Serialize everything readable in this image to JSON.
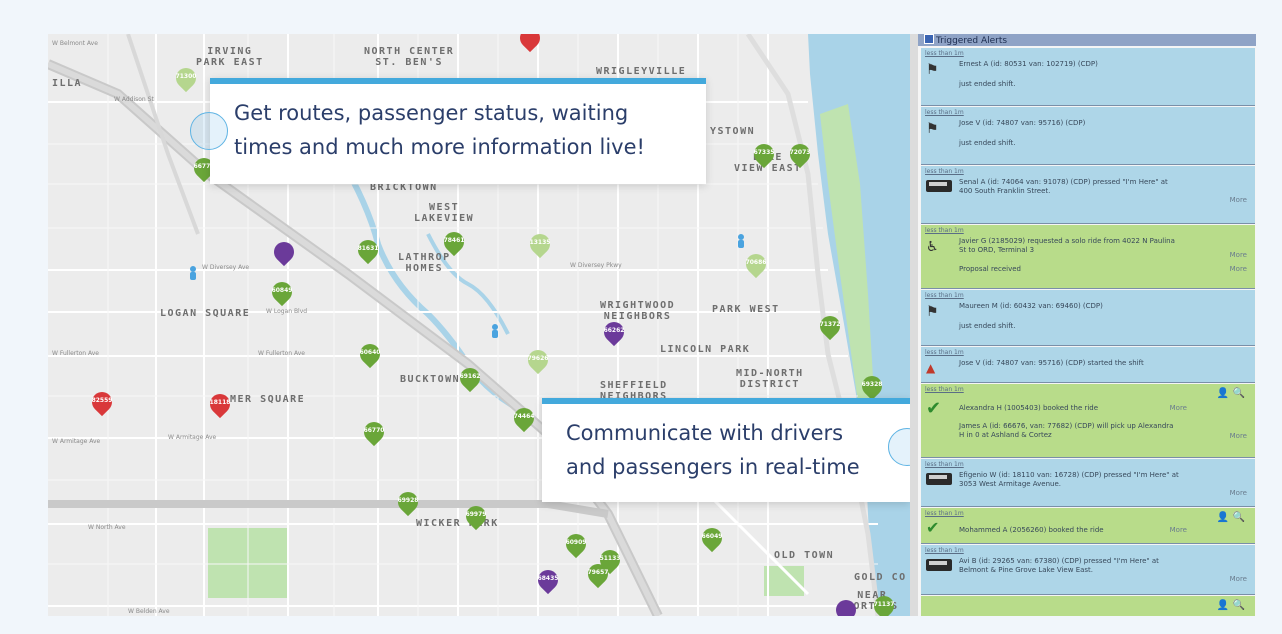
{
  "map": {
    "neighborhoods": [
      {
        "id": "irving-park-east",
        "text": "IRVING\nPARK EAST"
      },
      {
        "id": "north-center",
        "text": "NORTH CENTER\nST. BEN'S"
      },
      {
        "id": "wrigleyville",
        "text": "WRIGLEYVILLE"
      },
      {
        "id": "illa",
        "text": "ILLA"
      },
      {
        "id": "boystown",
        "text": "YSTOWN"
      },
      {
        "id": "lake-view-east",
        "text": "LAKE\nVIEW EAST"
      },
      {
        "id": "bricktown",
        "text": "BRICKTOWN"
      },
      {
        "id": "west-lakeview",
        "text": "WEST\nLAKEVIEW"
      },
      {
        "id": "lathrop-homes",
        "text": "LATHROP\nHOMES"
      },
      {
        "id": "wrightwood",
        "text": "WRIGHTWOOD\nNEIGHBORS"
      },
      {
        "id": "park-west",
        "text": "PARK WEST"
      },
      {
        "id": "logan-square",
        "text": "LOGAN SQUARE"
      },
      {
        "id": "lincoln-park",
        "text": "LINCOLN PARK"
      },
      {
        "id": "mid-north",
        "text": "MID-NORTH\nDISTRICT"
      },
      {
        "id": "bucktown",
        "text": "BUCKTOWN"
      },
      {
        "id": "sheffield",
        "text": "SHEFFIELD\nNEIGHBORS"
      },
      {
        "id": "palmer-square",
        "text": "MER SQUARE"
      },
      {
        "id": "wicker-park",
        "text": "WICKER PARK"
      },
      {
        "id": "old-town",
        "text": "OLD TOWN"
      },
      {
        "id": "gold-coast",
        "text": "GOLD CO"
      },
      {
        "id": "near-north",
        "text": "NEAR\nNORTH S"
      }
    ],
    "streets": [
      {
        "id": "addison",
        "text": "W Addison St"
      },
      {
        "id": "diversey-1",
        "text": "W Diversey Ave"
      },
      {
        "id": "diversey-2",
        "text": "W Diversey Pkwy"
      },
      {
        "id": "logan-blvd",
        "text": "W Logan Blvd"
      },
      {
        "id": "fullerton-1",
        "text": "W Fullerton Ave"
      },
      {
        "id": "fullerton-2",
        "text": "W Fullerton Ave"
      },
      {
        "id": "armitage-1",
        "text": "W Armitage Ave"
      },
      {
        "id": "armitage-2",
        "text": "W Armitage Ave"
      },
      {
        "id": "north-ave",
        "text": "W North Ave"
      },
      {
        "id": "belmont",
        "text": "W Belmont Ave"
      },
      {
        "id": "beldon",
        "text": "W Belden Ave"
      }
    ],
    "pins": [
      {
        "id": "p1",
        "number": "71300",
        "color": "lime"
      },
      {
        "id": "p2",
        "number": "",
        "color": "red"
      },
      {
        "id": "p3",
        "number": "66775",
        "color": "green"
      },
      {
        "id": "p4",
        "number": "72073",
        "color": "green"
      },
      {
        "id": "p5",
        "number": "67335",
        "color": "green"
      },
      {
        "id": "p6",
        "number": "81631",
        "color": "green"
      },
      {
        "id": "p7",
        "number": "78461",
        "color": "green"
      },
      {
        "id": "p8",
        "number": "13135",
        "color": "lime"
      },
      {
        "id": "p9",
        "number": "",
        "color": "purple"
      },
      {
        "id": "p10",
        "number": "60849",
        "color": "green"
      },
      {
        "id": "p11",
        "number": "70686",
        "color": "lime"
      },
      {
        "id": "p12",
        "number": "66262",
        "color": "purple"
      },
      {
        "id": "p13",
        "number": "71372",
        "color": "green"
      },
      {
        "id": "p14",
        "number": "60640",
        "color": "green"
      },
      {
        "id": "p15",
        "number": "79626",
        "color": "lime"
      },
      {
        "id": "p16",
        "number": "69162",
        "color": "green"
      },
      {
        "id": "p17",
        "number": "82559",
        "color": "red"
      },
      {
        "id": "p18",
        "number": "18118",
        "color": "red"
      },
      {
        "id": "p19",
        "number": "66770",
        "color": "green"
      },
      {
        "id": "p20",
        "number": "74464",
        "color": "green"
      },
      {
        "id": "p21",
        "number": "69928",
        "color": "green"
      },
      {
        "id": "p22",
        "number": "69979",
        "color": "green"
      },
      {
        "id": "p23",
        "number": "60909",
        "color": "green"
      },
      {
        "id": "p24",
        "number": "51133",
        "color": "green"
      },
      {
        "id": "p25",
        "number": "79657",
        "color": "green"
      },
      {
        "id": "p26",
        "number": "68435",
        "color": "purple"
      },
      {
        "id": "p27",
        "number": "66049",
        "color": "green"
      },
      {
        "id": "p28",
        "number": "69328",
        "color": "green"
      },
      {
        "id": "p29",
        "number": "71137",
        "color": "green"
      },
      {
        "id": "p30",
        "number": "",
        "color": "purple"
      }
    ],
    "callout_top": "Get routes, passenger status, waiting\ntimes and much more information live!",
    "callout_bottom": "Communicate with drivers\nand passengers in real-time"
  },
  "panel": {
    "header": "Triggered Alerts",
    "alerts": [
      {
        "time": "less than 1m",
        "icon": "checkered-flag-icon",
        "color": "blue",
        "line1": "Ernest A (id: 80531 van: 102719) (CDP)",
        "line2": "just ended shift.",
        "more": ""
      },
      {
        "time": "less than 1m",
        "icon": "checkered-flag-icon",
        "color": "blue",
        "line1": "Jose V (id: 74807 van: 95716) (CDP)",
        "line2": "just ended shift.",
        "more": ""
      },
      {
        "time": "less than 1m",
        "icon": "van-icon",
        "color": "blue",
        "line1": "Senal A (id: 74064 van: 91078) (CDP) pressed \"I'm Here\" at\n400 South Franklin Street.",
        "line2": "",
        "more": "More"
      },
      {
        "time": "less than 1m",
        "icon": "wheelchair-icon",
        "color": "green",
        "line1": "Javier G (2185029) requested a solo ride from 4022 N Paulina\nSt to ORD, Terminal 3",
        "line2": "Proposal received",
        "more": "More"
      },
      {
        "time": "less than 1m",
        "icon": "checkered-flag-icon",
        "color": "blue",
        "line1": "Maureen M (id: 60432 van: 69460) (CDP)",
        "line2": "just ended shift.",
        "more": ""
      },
      {
        "time": "less than 1m",
        "icon": "warning-icon",
        "color": "blue",
        "line1": "Jose V (id: 74807 van: 95716) (CDP) started the shift",
        "line2": "",
        "more": ""
      },
      {
        "time": "less than 1m",
        "icon": "check-icon",
        "color": "green",
        "line1": "Alexandra H (1005403) booked the ride",
        "line2": "James A (id: 66676, van: 77682) (CDP) will pick up Alexandra\nH in 0 at Ashland & Cortez",
        "more": "More"
      },
      {
        "time": "less than 1m",
        "icon": "van-icon",
        "color": "blue",
        "line1": "Efigenio W (id: 18110 van: 16728) (CDP) pressed \"I'm Here\" at\n3053 West Armitage Avenue.",
        "line2": "",
        "more": "More"
      },
      {
        "time": "less than 1m",
        "icon": "check-icon",
        "color": "green",
        "line1": "Mohammed A (2056260) booked the ride",
        "line2": "",
        "more": "More"
      },
      {
        "time": "less than 1m",
        "icon": "van-icon",
        "color": "blue",
        "line1": "Avi B (id: 29265 van: 67380) (CDP) pressed \"I'm Here\" at\nBelmont & Pine Grove Lake View East.",
        "line2": "",
        "more": "More"
      },
      {
        "time": "",
        "icon": "",
        "color": "green",
        "line1": "",
        "line2": "",
        "more": ""
      }
    ]
  }
}
